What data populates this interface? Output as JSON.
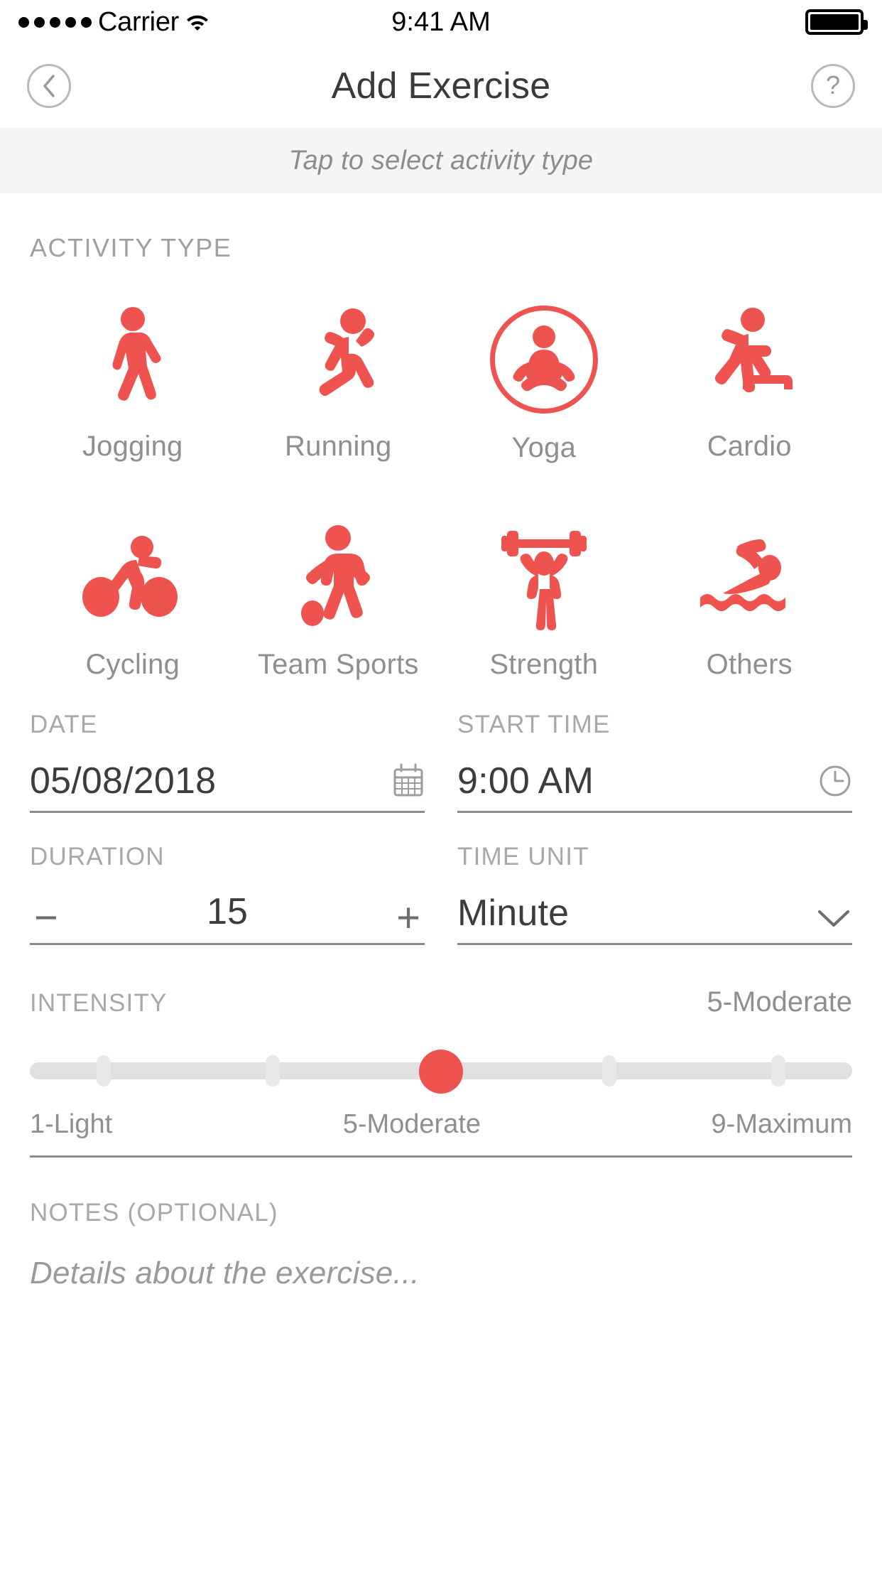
{
  "status_bar": {
    "carrier": "Carrier",
    "time": "9:41 AM",
    "signal_dots": 5,
    "wifi_icon": "wifi-icon",
    "battery_icon": "battery-full-icon"
  },
  "nav": {
    "back_icon": "chevron-left-icon",
    "title": "Add Exercise",
    "help_icon": "question-mark-icon"
  },
  "hint": {
    "text": "Tap to select activity type"
  },
  "activity": {
    "section_label": "ACTIVITY TYPE",
    "selected": "Yoga",
    "items": [
      {
        "label": "Jogging",
        "icon": "walking-person-icon",
        "selected": false
      },
      {
        "label": "Running",
        "icon": "running-person-icon",
        "selected": false
      },
      {
        "label": "Yoga",
        "icon": "lotus-pose-icon",
        "selected": true
      },
      {
        "label": "Cardio",
        "icon": "step-aerobics-icon",
        "selected": false
      },
      {
        "label": "Cycling",
        "icon": "cyclist-icon",
        "selected": false
      },
      {
        "label": "Team Sports",
        "icon": "soccer-player-icon",
        "selected": false
      },
      {
        "label": "Strength",
        "icon": "weightlifter-icon",
        "selected": false
      },
      {
        "label": "Others",
        "icon": "swimmer-icon",
        "selected": false
      }
    ]
  },
  "date_field": {
    "label": "DATE",
    "value": "05/08/2018",
    "icon": "calendar-icon"
  },
  "start_time_field": {
    "label": "START TIME",
    "value": "9:00 AM",
    "icon": "clock-icon"
  },
  "duration_field": {
    "label": "DURATION",
    "value": "15",
    "decrement_label": "−",
    "increment_label": "+"
  },
  "time_unit_field": {
    "label": "TIME UNIT",
    "value": "Minute",
    "icon": "chevron-down-icon",
    "options": [
      "Minute"
    ]
  },
  "intensity": {
    "label": "INTENSITY",
    "value_text": "5-Moderate",
    "value": 5,
    "min": 1,
    "max": 9,
    "scale_left": "1-Light",
    "scale_center": "5-Moderate",
    "scale_right": "9-Maximum"
  },
  "notes": {
    "label": "NOTES (OPTIONAL)",
    "placeholder": "Details about the exercise..."
  },
  "colors": {
    "accent": "#ef5350",
    "text_primary": "#3c3c3c",
    "text_muted": "#9a9a9a",
    "rule": "#8c8c8c",
    "banner_bg": "#f5f5f5"
  }
}
